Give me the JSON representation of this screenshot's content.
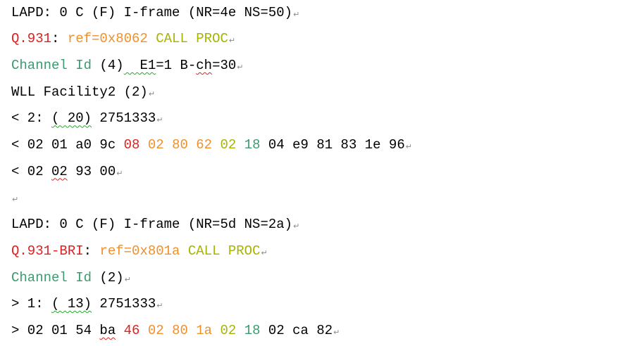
{
  "colors": {
    "default": "#000000",
    "red": "#e02020",
    "orange": "#f0902a",
    "yellowgreen": "#a8b400",
    "teal": "#3c9a6e",
    "mark": "#888888"
  },
  "para_mark": "↵",
  "lines": [
    {
      "segments": [
        {
          "t": "LAPD: 0 C (F) I-frame (NR=4e NS=50)",
          "c": "default"
        }
      ]
    },
    {
      "segments": [
        {
          "t": "Q.931",
          "c": "red"
        },
        {
          "t": ": ",
          "c": "default"
        },
        {
          "t": "ref=0x8062 ",
          "c": "orange"
        },
        {
          "t": "CALL PROC",
          "c": "yellowgreen"
        }
      ]
    },
    {
      "segments": [
        {
          "t": "Channel Id",
          "c": "teal"
        },
        {
          "t": " (4)",
          "c": "default"
        },
        {
          "t": "  E1",
          "c": "default",
          "u": "green"
        },
        {
          "t": "=1 B-",
          "c": "default"
        },
        {
          "t": "ch",
          "c": "default",
          "u": "red"
        },
        {
          "t": "=30",
          "c": "default"
        }
      ]
    },
    {
      "segments": [
        {
          "t": "WLL Facility2 (2)",
          "c": "default"
        }
      ]
    },
    {
      "segments": [
        {
          "t": "< 2: ",
          "c": "default"
        },
        {
          "t": "( 20)",
          "c": "default",
          "u": "green"
        },
        {
          "t": " 2751333",
          "c": "default"
        }
      ]
    },
    {
      "segments": [
        {
          "t": "< 02 01 a0 9c ",
          "c": "default"
        },
        {
          "t": "08 ",
          "c": "red"
        },
        {
          "t": "02 80 62 ",
          "c": "orange"
        },
        {
          "t": "02 ",
          "c": "yellowgreen"
        },
        {
          "t": "18 ",
          "c": "teal"
        },
        {
          "t": "04 e9 81 83 1e 96",
          "c": "default"
        }
      ]
    },
    {
      "segments": [
        {
          "t": "< 02 ",
          "c": "default"
        },
        {
          "t": "02",
          "c": "default",
          "u": "red"
        },
        {
          "t": " 93 00",
          "c": "default"
        }
      ]
    },
    {
      "segments": []
    },
    {
      "segments": [
        {
          "t": "LAPD: 0 C (F) I-frame (NR=5d NS=2a)",
          "c": "default"
        }
      ]
    },
    {
      "segments": [
        {
          "t": "Q.931-BRI",
          "c": "red"
        },
        {
          "t": ": ",
          "c": "default"
        },
        {
          "t": "ref=0x801a ",
          "c": "orange"
        },
        {
          "t": "CALL PROC",
          "c": "yellowgreen"
        }
      ]
    },
    {
      "segments": [
        {
          "t": "Channel Id",
          "c": "teal"
        },
        {
          "t": " (2)",
          "c": "default"
        }
      ]
    },
    {
      "segments": [
        {
          "t": "> 1: ",
          "c": "default"
        },
        {
          "t": "( 13)",
          "c": "default",
          "u": "green"
        },
        {
          "t": " 2751333",
          "c": "default"
        }
      ]
    },
    {
      "segments": [
        {
          "t": "> 02 01 54 ",
          "c": "default"
        },
        {
          "t": "ba",
          "c": "default",
          "u": "red"
        },
        {
          "t": " ",
          "c": "default"
        },
        {
          "t": "46 ",
          "c": "red"
        },
        {
          "t": "02 80 1a ",
          "c": "orange"
        },
        {
          "t": "02 ",
          "c": "yellowgreen"
        },
        {
          "t": "18 ",
          "c": "teal"
        },
        {
          "t": "02 ca 82",
          "c": "default"
        }
      ]
    }
  ]
}
